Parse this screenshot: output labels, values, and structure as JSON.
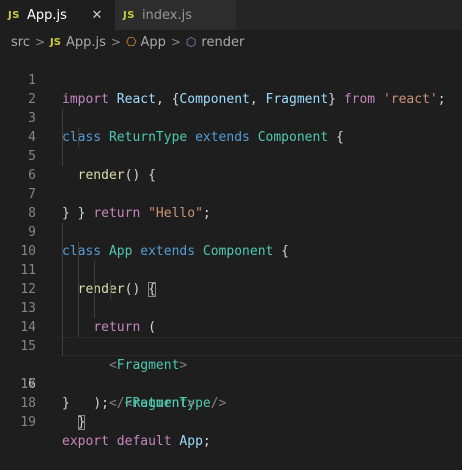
{
  "tabs": [
    {
      "icon": "JS",
      "title": "App.js",
      "close": "✕"
    },
    {
      "icon": "JS",
      "title": "index.js"
    }
  ],
  "breadcrumb": {
    "folder": "src",
    "file_icon": "JS",
    "file": "App.js",
    "class_icon": "⎔",
    "class_name": "App",
    "method_icon": "⬡",
    "method": "render",
    "separator": ">"
  },
  "editor": {
    "current_line": 16,
    "lines": [
      {
        "n": "1"
      },
      {
        "n": "2"
      },
      {
        "n": "3"
      },
      {
        "n": "4"
      },
      {
        "n": "5"
      },
      {
        "n": "6"
      },
      {
        "n": "7"
      },
      {
        "n": "8"
      },
      {
        "n": "9"
      },
      {
        "n": "10"
      },
      {
        "n": "11"
      },
      {
        "n": "12"
      },
      {
        "n": "13"
      },
      {
        "n": "14"
      },
      {
        "n": "15"
      },
      {
        "n": "16"
      },
      {
        "n": "17"
      },
      {
        "n": "18"
      },
      {
        "n": "19"
      }
    ],
    "tokens": {
      "l1_import": "import",
      "l1_react": "React",
      "l1_p1": ", {",
      "l1_component": "Component",
      "l1_p2": ", ",
      "l1_fragment": "Fragment",
      "l1_p3": "} ",
      "l1_from": "from",
      "l1_sp": " ",
      "l1_str": "'react'",
      "l1_semi": ";",
      "l3_class": "class",
      "l3_name": "ReturnType",
      "l3_extends": "extends",
      "l3_base": "Component",
      "l3_brace": " {",
      "l4_fn": "render",
      "l4_rest": "() {",
      "l5_return": "return",
      "l5_str": "\"Hello\"",
      "l5_semi": ";",
      "l6_brace": "}",
      "l7_brace": "}",
      "l9_class": "class",
      "l9_name": "App",
      "l9_extends": "extends",
      "l9_base": "Component",
      "l9_brace": " {",
      "l10_fn": "render",
      "l10_parens": "() ",
      "l10_brace": "{",
      "l11_return": "return",
      "l11_paren": " (",
      "l12_open": "<",
      "l12_tag": "Fragment",
      "l12_close": ">",
      "l13_open": "<",
      "l13_tag": "ReturnType",
      "l13_close": "/>",
      "l14_open": "</",
      "l14_tag": "Fragment",
      "l14_close": ">",
      "l15_text": ");",
      "l16_brace": "}",
      "l17_brace": "}",
      "l19_export": "export",
      "l19_default": "default",
      "l19_app": "App",
      "l19_semi": ";"
    }
  },
  "colors": {
    "background": "#1e1e1e",
    "keyword": "#569cd6",
    "control_keyword": "#c586c0",
    "class": "#4ec9b0",
    "variable": "#9cdcfe",
    "function": "#dcdcaa",
    "string": "#ce9178",
    "js_icon": "#cbcb41"
  }
}
